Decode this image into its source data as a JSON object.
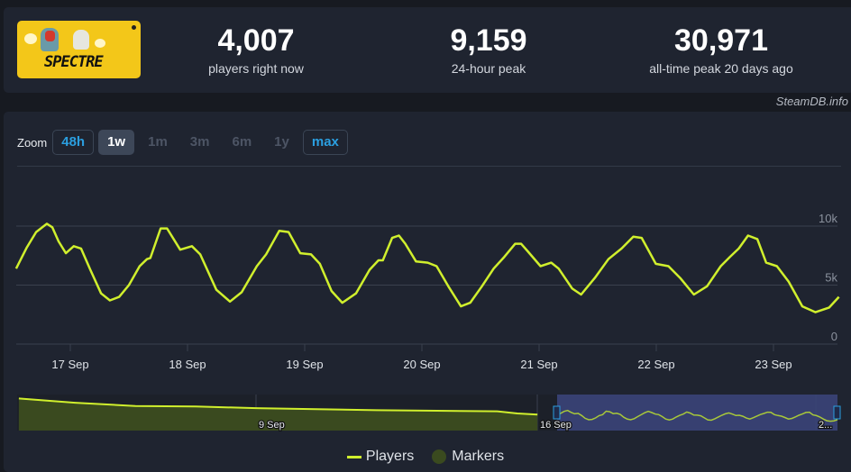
{
  "header": {
    "game_logo_alt": "SPECTRE",
    "stats": [
      {
        "value": "4,007",
        "label": "players right now"
      },
      {
        "value": "9,159",
        "label": "24-hour peak"
      },
      {
        "value": "30,971",
        "label": "all-time peak 20 days ago"
      }
    ],
    "credit": "SteamDB.info"
  },
  "zoom": {
    "label": "Zoom",
    "buttons": [
      {
        "label": "48h",
        "state": "link"
      },
      {
        "label": "1w",
        "state": "active"
      },
      {
        "label": "1m",
        "state": "disabled"
      },
      {
        "label": "3m",
        "state": "disabled"
      },
      {
        "label": "6m",
        "state": "disabled"
      },
      {
        "label": "1y",
        "state": "disabled"
      },
      {
        "label": "max",
        "state": "link"
      }
    ]
  },
  "legend": {
    "players": "Players",
    "markers": "Markers"
  },
  "colors": {
    "line": "#d0ef2d",
    "navigator_fill": "#3a4a1f",
    "selection": "#3b4479",
    "grid": "#3a414e",
    "link": "#2b9fe0"
  },
  "chart_data": {
    "type": "line",
    "title": "",
    "xlabel": "",
    "ylabel": "Players",
    "x_unit": "hours since 17 Sep 00:00",
    "xlim": [
      -11,
      157
    ],
    "ylim": [
      0,
      11000
    ],
    "yticks": [
      0,
      5000,
      10000
    ],
    "ytick_labels": [
      "0",
      "5k",
      "10k"
    ],
    "xticks": [
      0,
      24,
      48,
      72,
      96,
      120,
      144
    ],
    "xtick_labels": [
      "17 Sep",
      "18 Sep",
      "19 Sep",
      "20 Sep",
      "21 Sep",
      "22 Sep",
      "23 Sep"
    ],
    "grid": true,
    "legend_position": "bottom",
    "series": [
      {
        "name": "Players",
        "x": [
          -11.1,
          -8.9,
          -7.0,
          -4.8,
          -3.7,
          -2.4,
          -0.9,
          0.7,
          2.2,
          4.1,
          6.3,
          8.1,
          10.0,
          12.0,
          14.2,
          15.7,
          16.4,
          18.5,
          19.8,
          22.5,
          24.9,
          26.6,
          29.9,
          32.7,
          35.1,
          38.2,
          40.1,
          42.8,
          44.7,
          47.1,
          49.3,
          51.1,
          53.5,
          55.7,
          58.5,
          61.3,
          63.1,
          64.0,
          65.9,
          67.3,
          68.6,
          70.8,
          73.2,
          75.0,
          77.4,
          80.0,
          81.9,
          84.3,
          86.7,
          88.9,
          91.1,
          92.3,
          93.6,
          96.3,
          98.5,
          100.0,
          102.8,
          104.6,
          107.4,
          110.2,
          112.9,
          115.3,
          117.0,
          119.9,
          122.5,
          124.9,
          127.7,
          130.4,
          133.2,
          135.1,
          136.9,
          138.8,
          140.7,
          142.5,
          144.7,
          147.1,
          149.9,
          152.6,
          155.4,
          157.4
        ],
        "y": [
          6400,
          8200,
          9500,
          10200,
          9900,
          8700,
          7700,
          8300,
          8100,
          6300,
          4300,
          3700,
          4000,
          5000,
          6600,
          7200,
          7300,
          9800,
          9800,
          8000,
          8300,
          7600,
          4600,
          3600,
          4400,
          6600,
          7600,
          9600,
          9500,
          7700,
          7600,
          6800,
          4500,
          3500,
          4300,
          6300,
          7100,
          7100,
          9000,
          9200,
          8500,
          7000,
          6900,
          6600,
          4900,
          3200,
          3500,
          4900,
          6400,
          7400,
          8500,
          8500,
          7900,
          6600,
          6900,
          6400,
          4700,
          4200,
          5600,
          7200,
          8100,
          9100,
          9000,
          6800,
          6600,
          5600,
          4200,
          4900,
          6600,
          7400,
          8100,
          9200,
          8900,
          6900,
          6600,
          5300,
          3200,
          2700,
          3100,
          4000
        ]
      }
    ],
    "navigator": {
      "xtick_labels": [
        "9 Sep",
        "16 Sep",
        "2..."
      ],
      "selected_range": [
        "16 Sep",
        "23 Sep"
      ],
      "overview_days_since_9sep": [
        -5.9,
        -4.5,
        -3.0,
        -1.5,
        0,
        1.5,
        3.0,
        4.5,
        6.0,
        6.5,
        7.0
      ],
      "overview_values": [
        30000,
        26000,
        23000,
        22500,
        21000,
        20000,
        19000,
        18500,
        18000,
        16000,
        15000
      ]
    }
  }
}
